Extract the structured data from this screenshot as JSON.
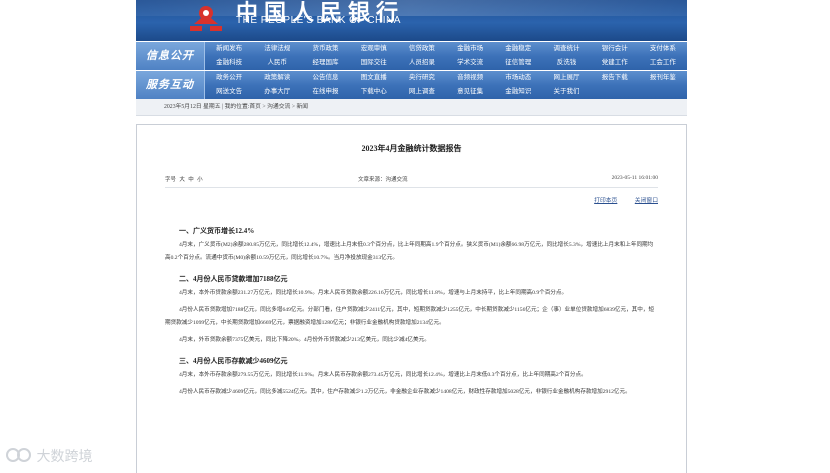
{
  "header": {
    "logo_cn": "中国人民银行",
    "logo_en": "THE PEOPLE'S BANK OF CHINA"
  },
  "nav": [
    {
      "label": "信息公开",
      "row1": [
        "新闻发布",
        "法律法规",
        "货币政策",
        "宏观审慎",
        "信贷政策",
        "金融市场",
        "金融稳定",
        "调查统计",
        "银行会计",
        "支付体系"
      ],
      "row2": [
        "金融科技",
        "人民币",
        "经理国库",
        "国际交往",
        "人员招录",
        "学术交流",
        "征信管理",
        "反洗钱",
        "党建工作",
        "工会工作"
      ]
    },
    {
      "label": "服务互动",
      "row1": [
        "政务公开",
        "政策解读",
        "公告信息",
        "图文直播",
        "央行研究",
        "音频视频",
        "市场动态",
        "网上展厅",
        "报告下载",
        "报刊年鉴"
      ],
      "row2": [
        "网送文告",
        "办事大厅",
        "在线申报",
        "下载中心",
        "网上调查",
        "意见征集",
        "金融知识",
        "关于我们"
      ]
    }
  ],
  "breadcrumb": "2023年5月12日 星期五 | 我的位置:首页 > 沟通交流 > 新闻",
  "article": {
    "title": "2023年4月金融统计数据报告",
    "font_label": "字号",
    "font_sizes": [
      "大",
      "中",
      "小"
    ],
    "source": "文章来源：沟通交流",
    "date": "2023-05-11 16:01:00",
    "print_label": "打印本页",
    "close_label": "关闭窗口",
    "sections": [
      {
        "heading": "一、广义货币增长12.4%",
        "paragraphs": [
          "4月末，广义货币(M2)余额280.85万亿元，同比增长12.4%，增速比上月末低0.3个百分点，比上年同期高1.9个百分点。狭义货币(M1)余额66.98万亿元，同比增长5.3%，增速比上月末和上年同期均高0.2个百分点。流通中货币(M0)余额10.59万亿元，同比增长10.7%。当月净投放现金313亿元。"
        ]
      },
      {
        "heading": "二、4月份人民币贷款增加7188亿元",
        "paragraphs": [
          "4月末，本外币贷款余额231.27万亿元，同比增长10.9%。月末人民币贷款余额226.16万亿元，同比增长11.8%，增速与上月末持平，比上年同期高0.9个百分点。",
          "4月份人民币贷款增加7188亿元，同比多增649亿元。分部门看，住户贷款减少2411亿元，其中，短期贷款减少1255亿元，中长期贷款减少1156亿元；企（事）业单位贷款增加6839亿元，其中，短期贷款减少1099亿元，中长期贷款增加6669亿元，票据融资增加1280亿元；非银行业金融机构贷款增加2134亿元。",
          "4月末，外币贷款余额7375亿美元，同比下降20%。4月份外币贷款减少213亿美元，同比少减4亿美元。"
        ]
      },
      {
        "heading": "三、4月份人民币存款减少4609亿元",
        "paragraphs": [
          "4月末，本外币存款余额279.55万亿元，同比增长11.9%。月末人民币存款余额273.45万亿元，同比增长12.4%，增速比上月末低0.3个百分点，比上年同期高2个百分点。",
          "4月份人民币存款减少4609亿元，同比多减5524亿元。其中，住户存款减少1.2万亿元，非金融企业存款减少1408亿元，财政性存款增加5028亿元，非银行业金融机构存款增加2912亿元。"
        ]
      }
    ]
  },
  "watermark": "大数跨境"
}
